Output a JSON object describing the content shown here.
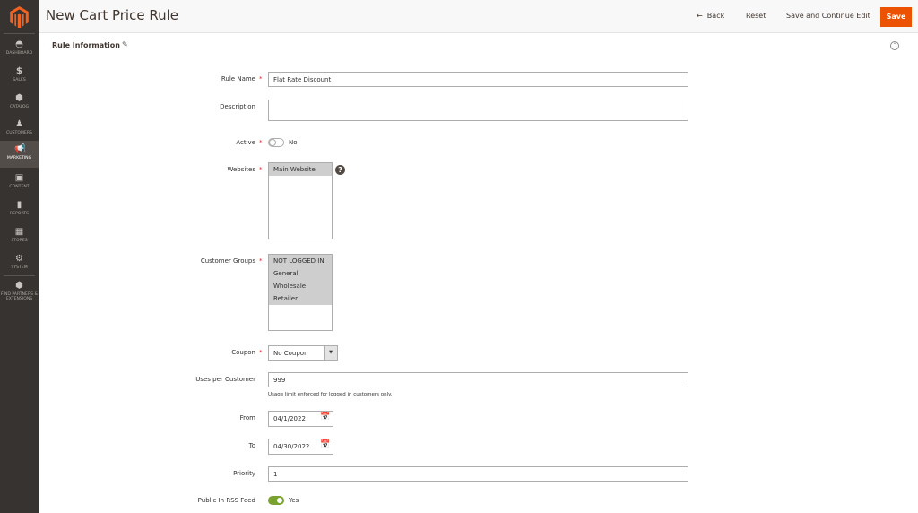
{
  "sidebar": {
    "items": [
      {
        "label": "DASHBOARD",
        "icon": "dashboard-icon"
      },
      {
        "label": "SALES",
        "icon": "dollar-icon"
      },
      {
        "label": "CATALOG",
        "icon": "box-icon"
      },
      {
        "label": "CUSTOMERS",
        "icon": "person-icon"
      },
      {
        "label": "MARKETING",
        "icon": "megaphone-icon",
        "active": true
      },
      {
        "label": "CONTENT",
        "icon": "layout-icon"
      },
      {
        "label": "REPORTS",
        "icon": "bar-chart-icon"
      },
      {
        "label": "STORES",
        "icon": "storefront-icon"
      },
      {
        "label": "SYSTEM",
        "icon": "gear-icon"
      },
      {
        "label": "FIND PARTNERS & EXTENSIONS",
        "icon": "partners-box-icon"
      }
    ]
  },
  "header": {
    "title": "New Cart Price Rule",
    "back": "Back",
    "reset": "Reset",
    "save_continue": "Save and Continue Edit",
    "save": "Save"
  },
  "section": {
    "title": "Rule Information"
  },
  "form": {
    "rule_name": {
      "label": "Rule Name",
      "value": "Flat Rate Discount"
    },
    "description": {
      "label": "Description",
      "value": ""
    },
    "active": {
      "label": "Active",
      "value": "No"
    },
    "websites": {
      "label": "Websites",
      "options": [
        "Main Website"
      ]
    },
    "customer_groups": {
      "label": "Customer Groups",
      "options": [
        "NOT LOGGED IN",
        "General",
        "Wholesale",
        "Retailer"
      ]
    },
    "coupon": {
      "label": "Coupon",
      "value": "No Coupon"
    },
    "uses_per_customer": {
      "label": "Uses per Customer",
      "value": "999",
      "note": "Usage limit enforced for logged in customers only."
    },
    "from": {
      "label": "From",
      "value": "04/1/2022"
    },
    "to": {
      "label": "To",
      "value": "04/30/2022"
    },
    "priority": {
      "label": "Priority",
      "value": "1"
    },
    "rss": {
      "label": "Public In RSS Feed",
      "value": "Yes"
    }
  },
  "colors": {
    "accent": "#eb5202",
    "sidebar": "#373330",
    "toggle_on": "#79a22e"
  }
}
